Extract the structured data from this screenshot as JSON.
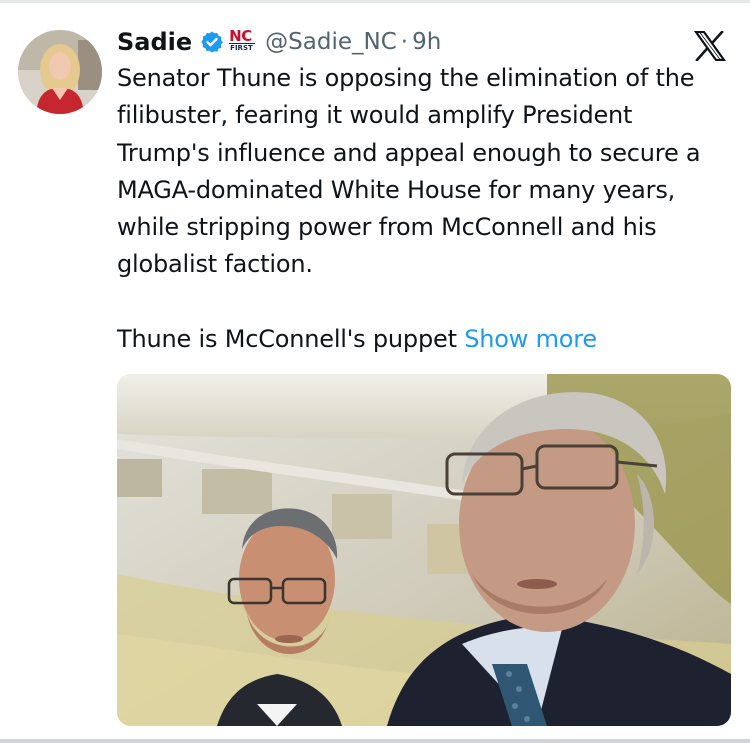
{
  "user": {
    "display_name": "Sadie",
    "handle": "@Sadie_NC",
    "separator": "·",
    "time": "9h",
    "affiliation_badge": {
      "top_text": "NC",
      "bottom_text": "FIRST"
    },
    "verified_color": "#1d9bf0"
  },
  "tweet": {
    "paragraph_1": "Senator Thune is opposing the elimination of the filibuster, fearing it would amplify President Trump's influence and appeal enough to secure a MAGA-dominated White House for many years, while stripping power from McConnell and his globalist faction.",
    "paragraph_2": "Thune is McConnell's puppet",
    "show_more_label": "Show more"
  },
  "icons": {
    "verified": "verified-badge-icon",
    "platform": "x-logo-icon"
  },
  "colors": {
    "text": "#0f1419",
    "secondary": "#536471",
    "link": "#1d9bf0"
  }
}
